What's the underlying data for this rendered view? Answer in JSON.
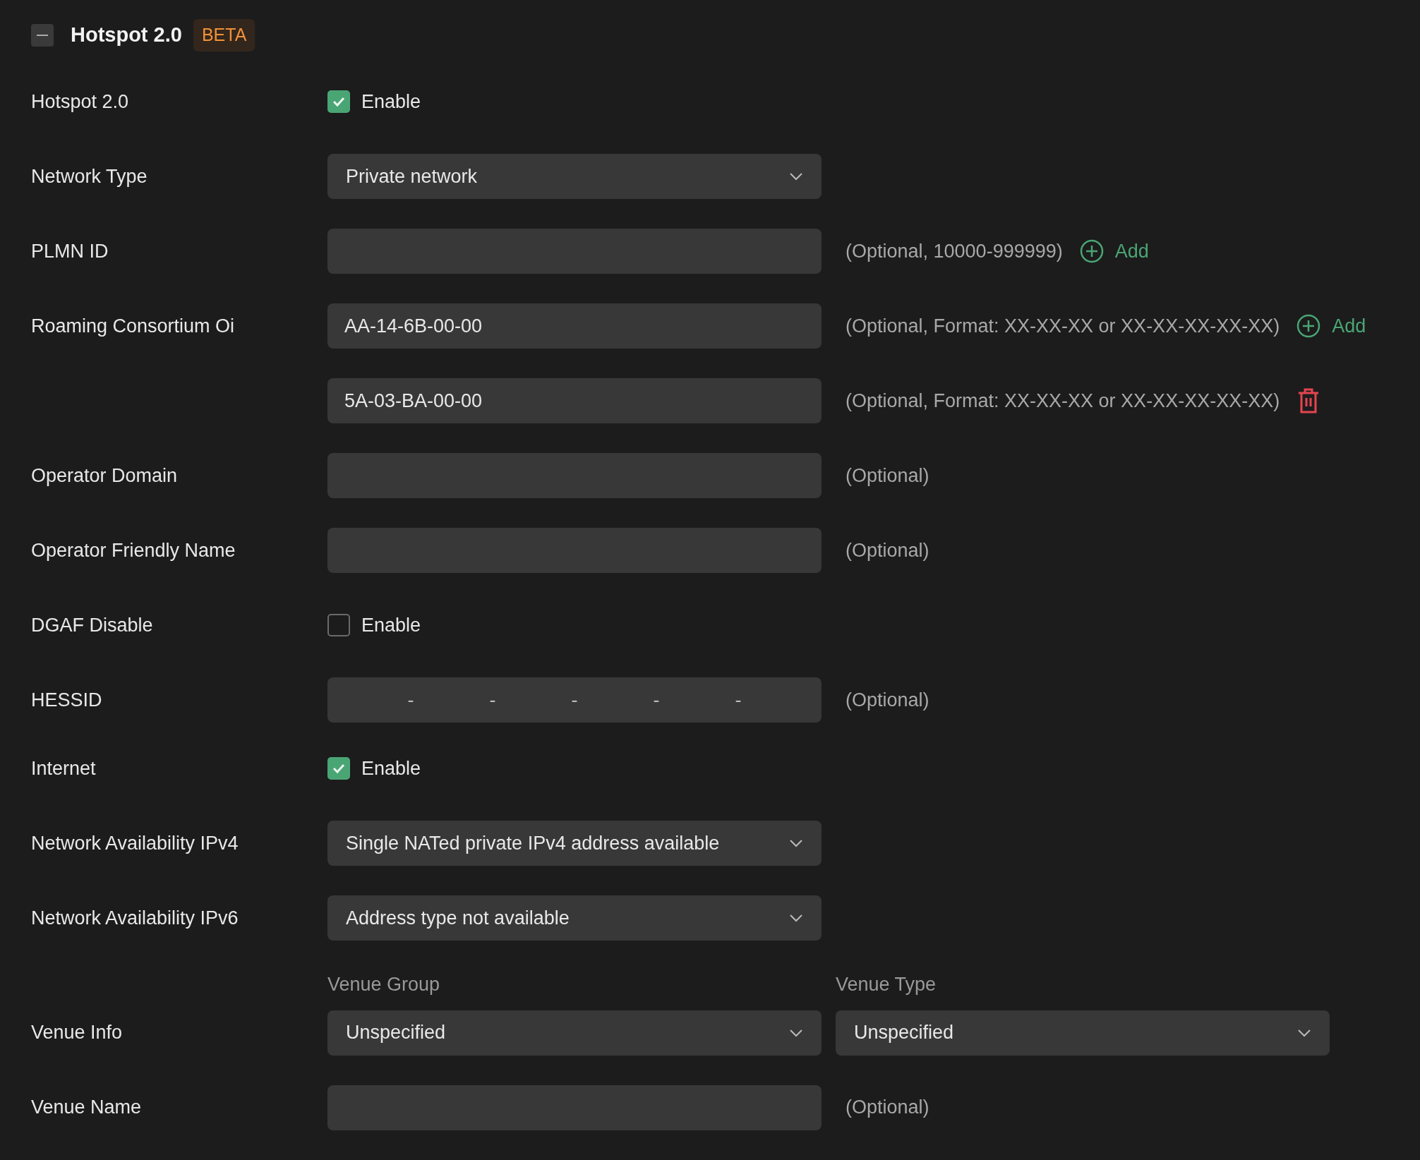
{
  "section": {
    "title": "Hotspot 2.0",
    "badge": "BETA",
    "expanded": true
  },
  "rows": [
    {
      "kind": "checkbox",
      "label": "Hotspot 2.0",
      "option": "Enable",
      "checked": true
    },
    {
      "kind": "select",
      "label": "Network Type",
      "value": "Private network"
    },
    {
      "kind": "input",
      "label": "PLMN ID",
      "hint": "(Optional, 10000-999999)",
      "action": {
        "kind": "add",
        "label": "Add"
      }
    },
    {
      "kind": "input",
      "label": "Roaming Consortium Oi",
      "value": "AA-14-6B-00-00",
      "hint": "(Optional, Format: XX-XX-XX or XX-XX-XX-XX-XX)",
      "action": {
        "kind": "add",
        "label": "Add"
      }
    },
    {
      "kind": "input",
      "value": "5A-03-BA-00-00",
      "hint": "(Optional, Format: XX-XX-XX or XX-XX-XX-XX-XX)",
      "action": {
        "kind": "delete"
      }
    },
    {
      "kind": "input",
      "label": "Operator Domain",
      "hint": "(Optional)"
    },
    {
      "kind": "input",
      "label": "Operator Friendly Name",
      "hint": "(Optional)"
    },
    {
      "kind": "checkbox",
      "label": "DGAF Disable",
      "option": "Enable",
      "checked": false
    },
    {
      "kind": "hessid",
      "label": "HESSID",
      "separators": [
        "-",
        "-",
        "-",
        "-",
        "-"
      ],
      "hint": "(Optional)"
    },
    {
      "kind": "checkbox",
      "label": "Internet",
      "option": "Enable",
      "checked": true
    },
    {
      "kind": "select",
      "label": "Network Availability IPv4",
      "value": "Single NATed private IPv4 address available"
    },
    {
      "kind": "select",
      "label": "Network Availability IPv6",
      "value": "Address type not available"
    },
    {
      "kind": "venue",
      "label": "Venue Info",
      "selects": [
        {
          "caption": "Venue Group",
          "value": "Unspecified"
        },
        {
          "caption": "Venue Type",
          "value": "Unspecified"
        }
      ]
    },
    {
      "kind": "input",
      "label": "Venue Name",
      "hint": "(Optional)"
    }
  ]
}
